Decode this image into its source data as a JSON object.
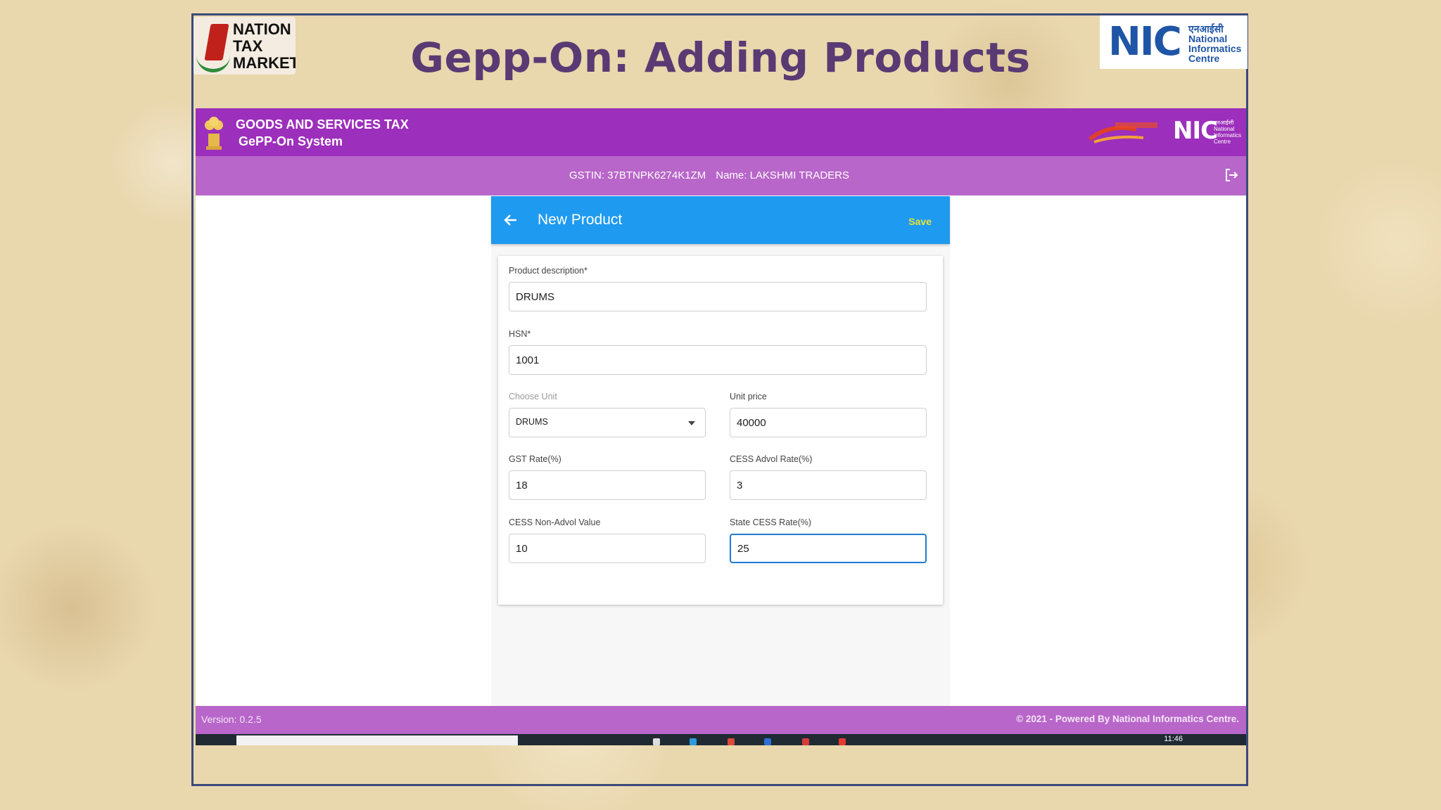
{
  "slide": {
    "title": "Gepp-On: Adding Products",
    "logo_left_lines": [
      "NATION",
      "TAX",
      "MARKET"
    ],
    "logo_right_big": "NIC",
    "logo_right_small": [
      "एनआईसी",
      "National",
      "Informatics",
      "Centre"
    ]
  },
  "header": {
    "title": "GOODS AND SERVICES TAX",
    "subtitle": "GePP-On System",
    "nic_text": "NIC"
  },
  "subbar": {
    "gstin": "GSTIN: 37BTNPK6274K1ZM",
    "name": "Name: LAKSHMI TRADERS"
  },
  "panel": {
    "title": "New Product",
    "save_label": "Save"
  },
  "form": {
    "product_description": {
      "label": "Product description*",
      "value": "DRUMS"
    },
    "hsn": {
      "label": "HSN*",
      "value": "1001"
    },
    "choose_unit": {
      "label": "Choose Unit",
      "value": "DRUMS"
    },
    "unit_price": {
      "label": "Unit price",
      "value": "40000"
    },
    "gst_rate": {
      "label": "GST Rate(%)",
      "value": "18"
    },
    "cess_advol_rate": {
      "label": "CESS Advol Rate(%)",
      "value": "3"
    },
    "cess_non_advol_value": {
      "label": "CESS Non-Advol Value",
      "value": "10"
    },
    "state_cess_rate": {
      "label": "State CESS Rate(%)",
      "value": "25"
    }
  },
  "footer": {
    "version": "Version: 0.2.5",
    "copyright": "© 2021 - Powered By National Informatics Centre."
  },
  "taskbar": {
    "time": "11:46"
  },
  "colors": {
    "header_purple": "#9c2fbb",
    "subbar_purple": "#b866c9",
    "panel_blue": "#1e9af0",
    "save_yellow": "#e8e33a",
    "title_purple": "#5a3a73"
  }
}
